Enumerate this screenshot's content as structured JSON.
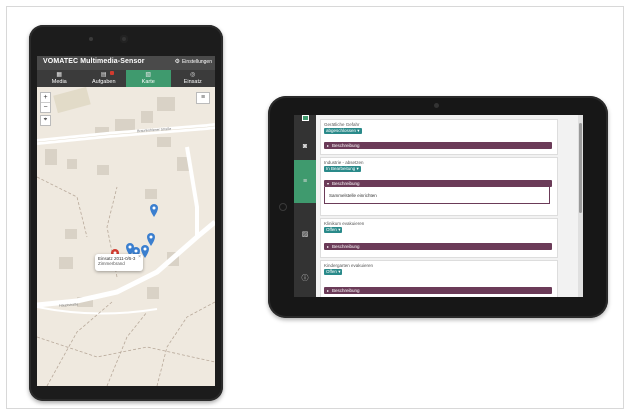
{
  "phone": {
    "app_title": "VOMATEC Multimedia-Sensor",
    "settings_label": "Einstellungen",
    "tabs": [
      {
        "label": "Media",
        "icon": "film-icon"
      },
      {
        "label": "Aufgaben",
        "icon": "tasks-icon"
      },
      {
        "label": "Karte",
        "icon": "map-icon",
        "active": true
      },
      {
        "label": "Einsatz",
        "icon": "target-icon"
      }
    ],
    "map": {
      "zoom_in": "+",
      "zoom_out": "−",
      "street_label_1": "Braunkohlener Straße",
      "street_label_2": "Hauptstraße",
      "popup_line1": "Einsatz 2011-0/5-3",
      "popup_line2": "Zimmerbrand",
      "popup_close": "×"
    }
  },
  "tablet": {
    "sidebar_icons": [
      "camera-icon",
      "list-icon",
      "image-icon",
      "info-icon"
    ],
    "tasks": [
      {
        "name": "Gerätliche Gefahr",
        "status": "abgeschlossen",
        "description_label": "Beschreibung",
        "expanded": false
      },
      {
        "name": "Industrie - absetzen",
        "status": "In Bearbeitung",
        "description_label": "Beschreibung",
        "expanded": true,
        "body": "Sammelstelle einrichten"
      },
      {
        "name": "Klinikum evakuieren",
        "status": "Offen",
        "description_label": "Beschreibung",
        "expanded": false
      },
      {
        "name": "Kindergarten evakuieren",
        "status": "Offen",
        "description_label": "Beschreibung",
        "expanded": false
      }
    ]
  },
  "colors": {
    "accent_green": "#3f9a6e",
    "status_teal": "#2a8a8a",
    "description_purple": "#6b3b58",
    "marker_blue": "#3b7fcf",
    "marker_red": "#d23b2f"
  }
}
